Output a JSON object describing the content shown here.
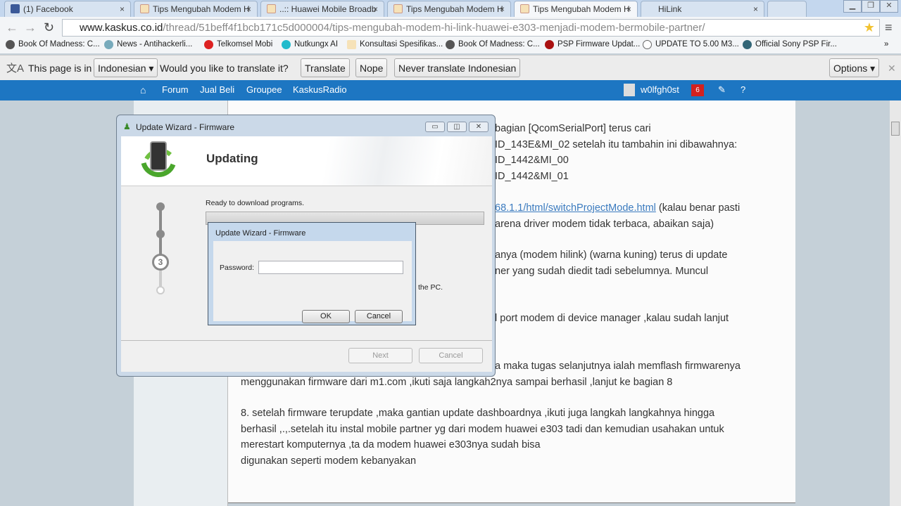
{
  "browser": {
    "tabs": [
      {
        "label": "(1) Facebook"
      },
      {
        "label": "Tips Mengubah Modem H"
      },
      {
        "label": "..:: Huawei Mobile Broadb"
      },
      {
        "label": "Tips Mengubah Modem H"
      },
      {
        "label": "Tips Mengubah Modem H"
      },
      {
        "label": "HiLink"
      }
    ],
    "url_host": "www.kaskus.co.id",
    "url_path": "/thread/51beff4f1bcb171c5d000004/tips-mengubah-modem-hi-link-huawei-e303-menjadi-modem-bermobile-partner/",
    "bookmarks": [
      "Book Of Madness: C...",
      "News - Antihackerli...",
      "Telkomsel Mobi",
      "Nutkungx AI",
      "Konsultasi Spesifikas...",
      "Book Of Madness: C...",
      "PSP Firmware Updat...",
      "UPDATE TO 5.00 M3...",
      "Official Sony PSP Fir..."
    ],
    "bookmarks_more": "»"
  },
  "translate": {
    "prefix": "This page is in",
    "language": "Indonesian ▾",
    "question": "Would you like to translate it?",
    "translate": "Translate",
    "nope": "Nope",
    "never": "Never translate Indonesian",
    "options": "Options ▾",
    "close": "✕"
  },
  "sitenav": {
    "items": [
      "Forum",
      "Jual Beli",
      "Groupee",
      "KaskusRadio"
    ],
    "user": "w0lfgh0st",
    "notif_count": "6"
  },
  "article": {
    "lines": [
      "bagian [QcomSerialPort] terus cari",
      "ID_143E&MI_02 setelah itu tambahin ini dibawahnya:",
      "ID_1442&MI_00",
      "ID_1442&MI_01"
    ],
    "link": "68.1.1/html/switchProjectMode.html",
    "link_after": " (kalau benar pasti",
    "lines2": [
      "arena driver modem tidak terbaca, abaikan saja)",
      "anya (modem hilink) (warna kuning) terus di update",
      "ner yang sudah diedit tadi sebelumnya. Muncul",
      "l port modem di device manager ,kalau sudah lanjut",
      "a maka tugas selanjutnya ialah memflash firmwarenya",
      "menggunakan firmware dari m1.com ,ikuti saja langkah2nya sampai berhasil ,lanjut ke bagian 8",
      "8. setelah firmware terupdate ,maka gantian update dashboardnya ,ikuti juga langkah langkahnya hingga",
      "berhasil ,.,.setelah itu instal mobile partner yg dari modem huawei e303 tadi dan kemudian usahakan untuk",
      "merestart komputernya ,ta da modem huawei e303nya sudah bisa",
      "digunakan seperti modem kebanyakan"
    ]
  },
  "wizard": {
    "title": "Update Wizard - Firmware",
    "heading": "Updating",
    "status": "Ready to download programs.",
    "step": "3",
    "partial": "the PC.",
    "next": "Next",
    "cancel": "Cancel",
    "progress": 0
  },
  "password_dialog": {
    "title": "Update Wizard - Firmware",
    "label": "Password:",
    "value": "",
    "ok": "OK",
    "cancel": "Cancel"
  }
}
